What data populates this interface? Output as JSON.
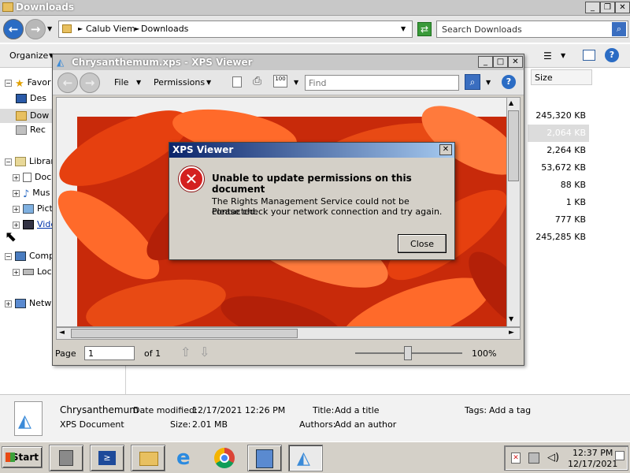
{
  "explorer": {
    "title": "Downloads",
    "breadcrumb": [
      "Calub Viem",
      "Downloads"
    ],
    "search_placeholder": "Search Downloads",
    "organize_label": "Organize",
    "nav": [
      {
        "label": "Favor",
        "toggle": "−"
      },
      {
        "label": "Des",
        "toggle": ""
      },
      {
        "label": "Dow",
        "toggle": ""
      },
      {
        "label": "Rec",
        "toggle": ""
      },
      {
        "label": "Librar",
        "toggle": "−"
      },
      {
        "label": "Doc",
        "toggle": "+"
      },
      {
        "label": "Mus",
        "toggle": "+"
      },
      {
        "label": "Pict",
        "toggle": "+"
      },
      {
        "label": "Vide",
        "toggle": "+"
      },
      {
        "label": "Comp",
        "toggle": "−"
      },
      {
        "label": "Loc",
        "toggle": "+"
      },
      {
        "label": "Netw",
        "toggle": "+"
      }
    ],
    "size_header": "Size",
    "sizes": [
      "245,320 KB",
      "2,064 KB",
      "2,264 KB",
      "53,672 KB",
      "88 KB",
      "1 KB",
      "777 KB",
      "245,285 KB"
    ]
  },
  "details": {
    "name": "Chrysanthemum",
    "type": "XPS Document",
    "date_label": "Date modified:",
    "date_value": "12/17/2021 12:26 PM",
    "size_label": "Size:",
    "size_value": "2.01 MB",
    "title_label": "Title:",
    "title_value": "Add a title",
    "authors_label": "Authors:",
    "authors_value": "Add an author",
    "tags_label": "Tags:",
    "tags_value": "Add a tag"
  },
  "xps": {
    "title": "Chrysanthemum.xps - XPS Viewer",
    "file_menu": "File",
    "permissions_menu": "Permissions",
    "find_placeholder": "Find",
    "page_label": "Page",
    "page_value": "1",
    "page_of": "of 1",
    "zoom": "100%"
  },
  "dialog": {
    "title": "XPS Viewer",
    "heading": "Unable to update permissions on this document",
    "line1": "The Rights Management Service could not be contacted.",
    "line2": "Please check your network connection and try again.",
    "close_label": "Close"
  },
  "taskbar": {
    "start_label": "Start",
    "time": "12:37 PM",
    "date": "12/17/2021"
  },
  "colors": {
    "petal_dark": "#b32008",
    "petal_mid": "#e6400f",
    "petal_light": "#ff7a3c",
    "dialog_title_start": "#0a246a",
    "error_red": "#d42020"
  }
}
